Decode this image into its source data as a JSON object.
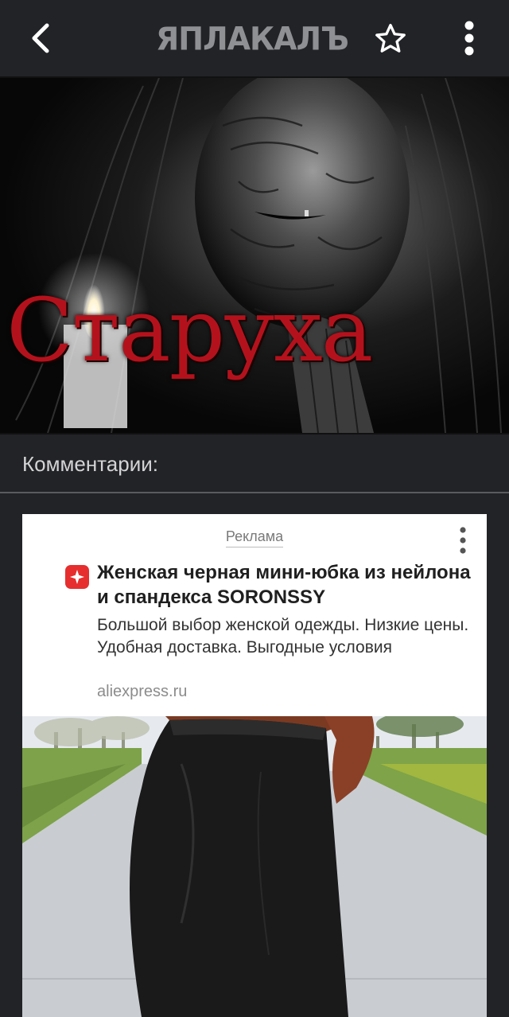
{
  "topbar": {
    "back_icon": "chevron-left-icon",
    "logo_text": "ЯПЛАКАЛЪ",
    "favorite_icon": "star-outline-icon",
    "menu_icon": "vertical-dots-icon"
  },
  "hero": {
    "title_text": "Старуха"
  },
  "comments": {
    "title": "Комментарии:"
  },
  "ad": {
    "label": "Реклама",
    "menu_icon": "vertical-dots-icon",
    "favicon_icon": "aliexpress-icon",
    "headline": "Женская черная мини-юбка из нейлона и спандекса SORONSSY",
    "description": "Большой выбор женской одежды. Низкие цены. Удобная доставка. Выгодные условия",
    "domain": "aliexpress.ru"
  },
  "colors": {
    "background": "#222326",
    "hero_title": "#b3121c",
    "ad_favicon": "#e62e2e",
    "comments_text": "#d4d4d6"
  }
}
